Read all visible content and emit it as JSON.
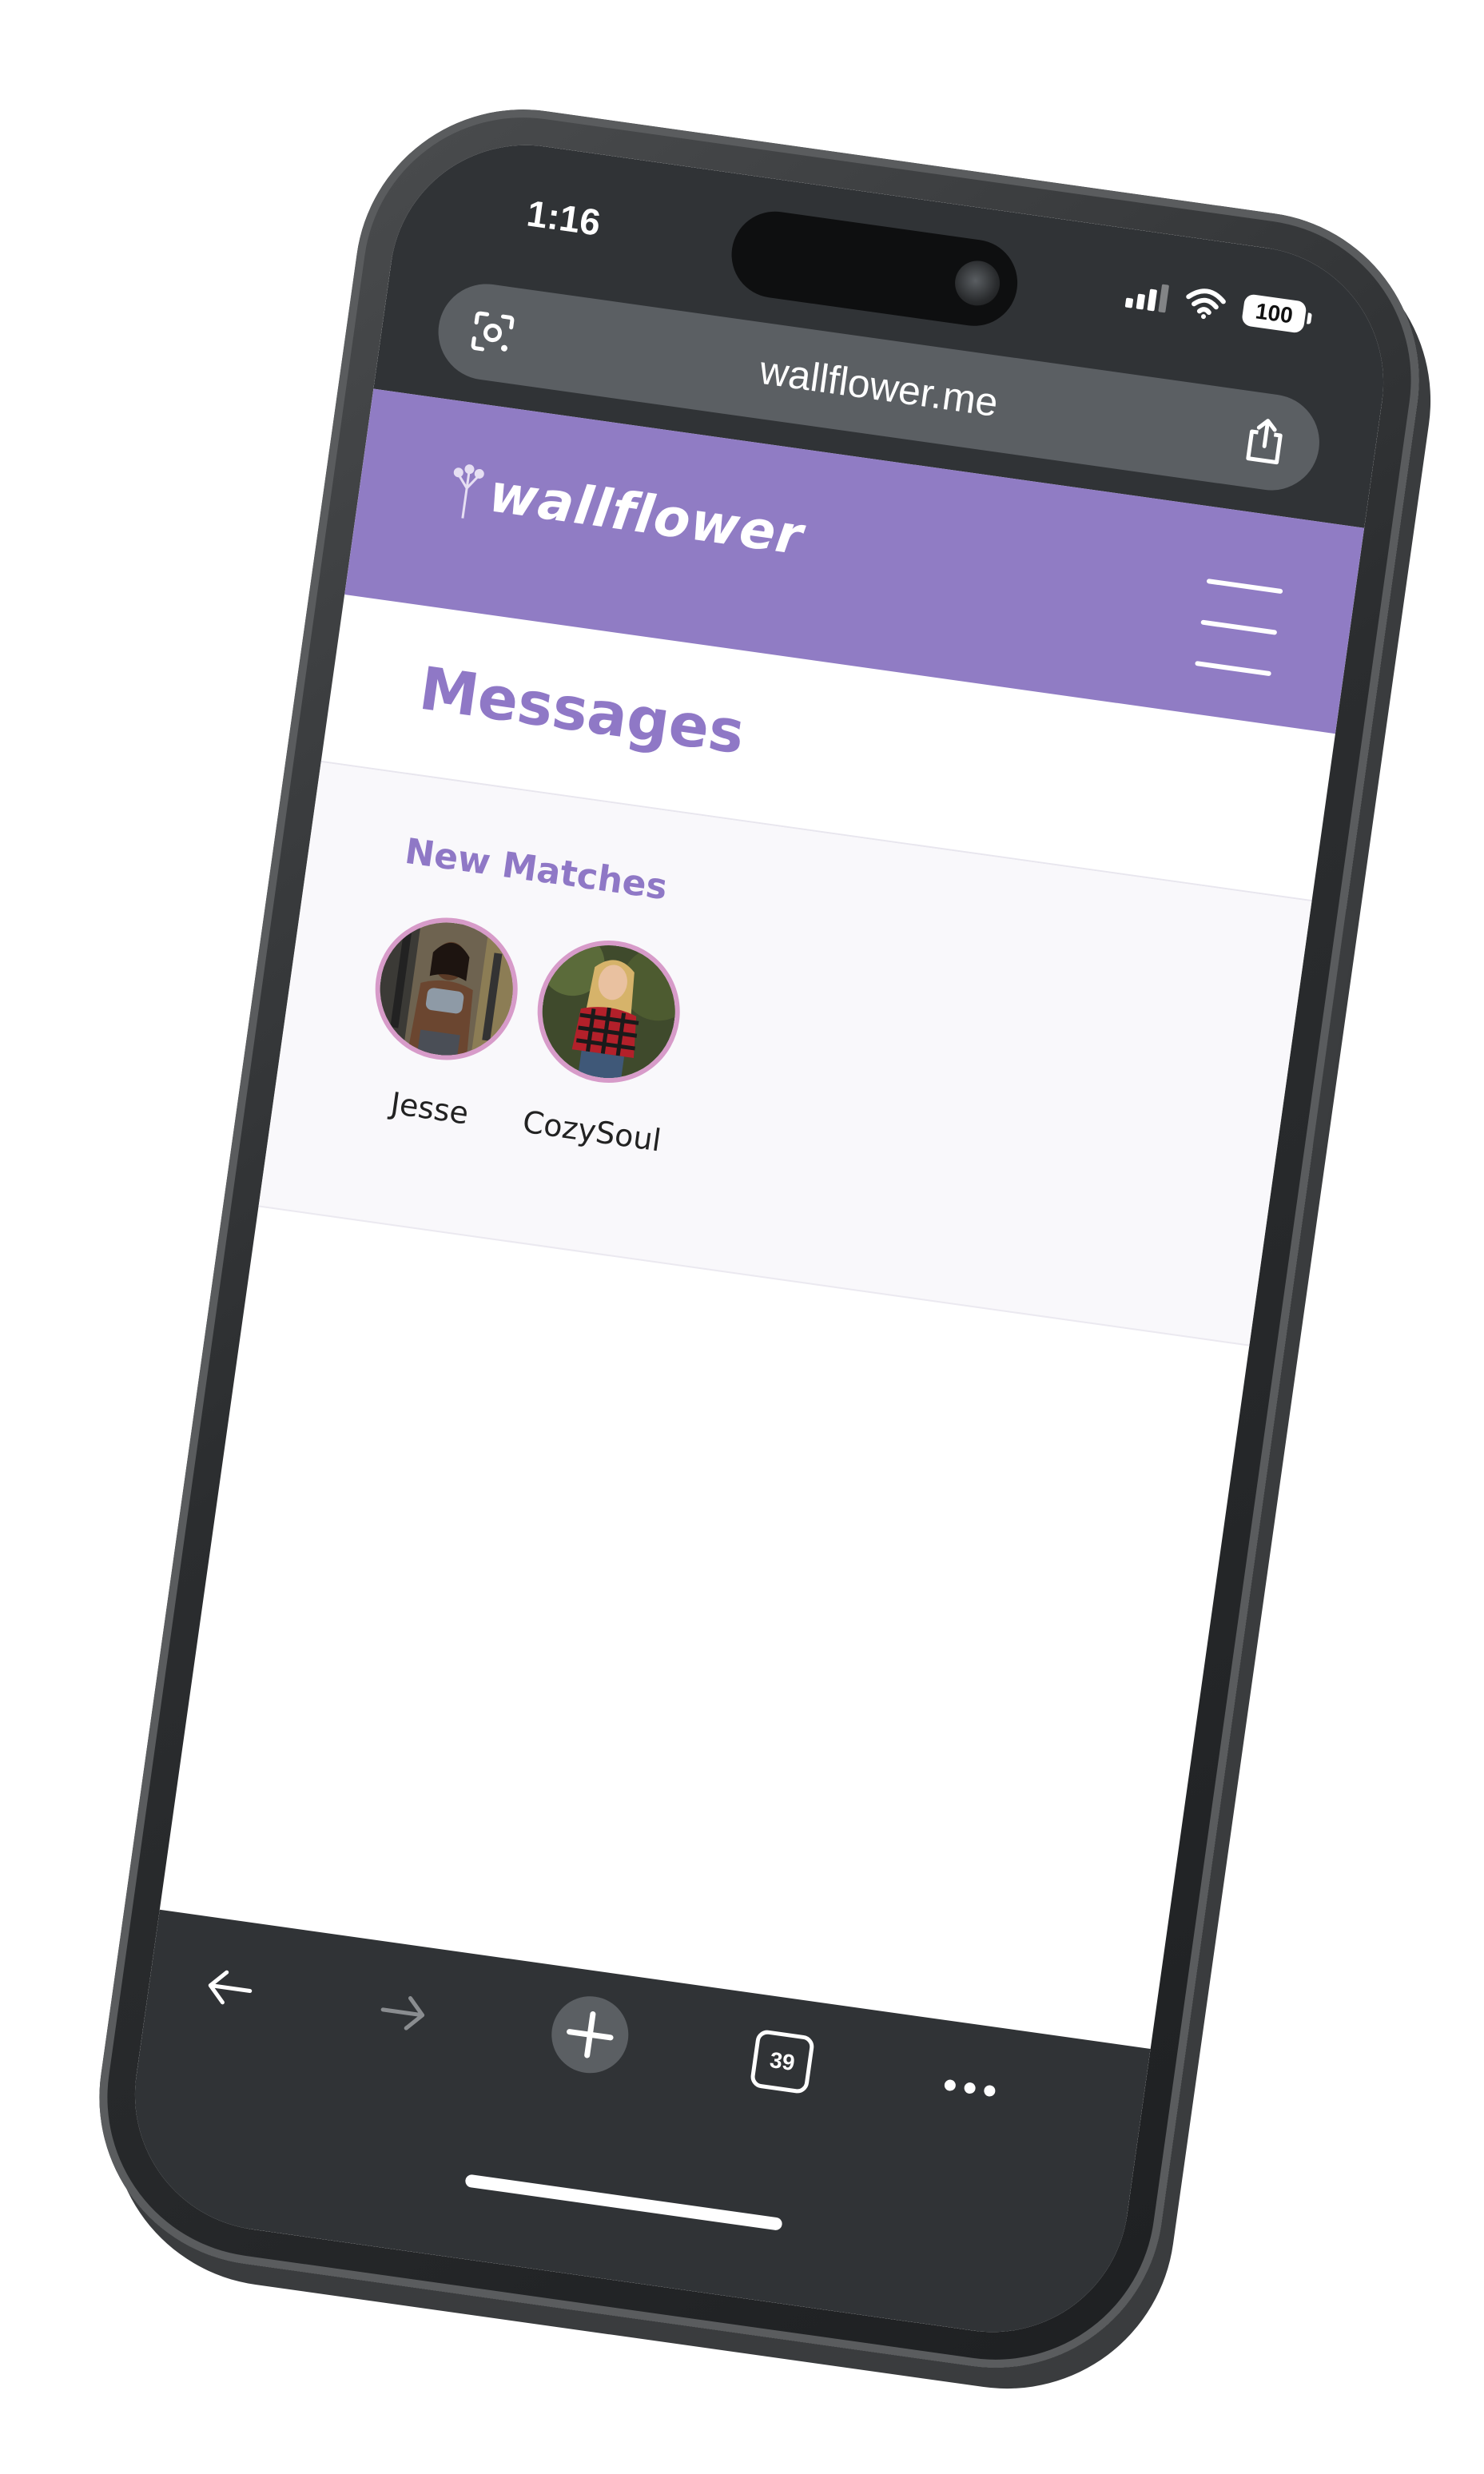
{
  "status_bar": {
    "time": "1:16",
    "battery": "100"
  },
  "browser": {
    "url": "wallflower.me",
    "tabs_count": "39"
  },
  "app": {
    "logo": "wallflower"
  },
  "page": {
    "title": "Messages"
  },
  "matches": {
    "heading": "New Matches",
    "items": [
      {
        "name": "Jesse"
      },
      {
        "name": "CozySoul"
      }
    ]
  },
  "icons": {
    "lens": "lens-icon",
    "share": "share-icon",
    "menu": "hamburger-menu-icon",
    "back": "arrow-left-icon",
    "forward": "arrow-right-icon",
    "new_tab": "plus-icon",
    "tabs": "tabs-icon",
    "more": "more-icon"
  },
  "colors": {
    "brand_purple": "#907cc4",
    "title_purple": "#8f78c6",
    "avatar_ring": "#d79bc9",
    "browser_chrome": "#303336",
    "address_bar": "#5b5f63"
  }
}
